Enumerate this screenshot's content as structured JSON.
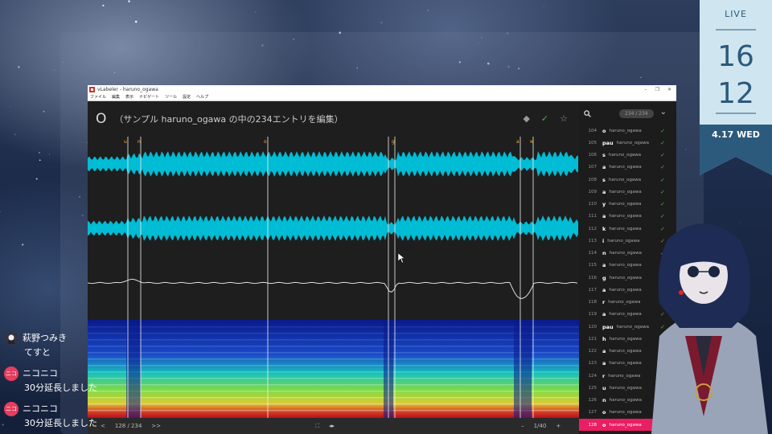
{
  "window": {
    "title": "vLabeler - haruno_ogawa",
    "menu": [
      "ファイル",
      "編集",
      "表示",
      "ナビゲート",
      "ツール",
      "設定",
      "ヘルプ"
    ],
    "controls": [
      "–",
      "❐",
      "✕"
    ]
  },
  "editor": {
    "entry_name": "O",
    "description": "（サンプル haruno_ogawa の中の234エントリを編集）",
    "markers": [
      "u",
      "n",
      "o",
      "g",
      "a",
      "w"
    ],
    "position": "128 / 234",
    "prev_buttons": "<",
    "next_buttons": ">>",
    "zoom": "1/40",
    "minus": "–",
    "plus": "+",
    "accent": "#00bcd4"
  },
  "sidebar": {
    "count": "234 / 234",
    "rows": [
      {
        "index": "104",
        "text": "o",
        "singer": "haruno_ogawa"
      },
      {
        "index": "105",
        "text": "pau",
        "singer": "haruno_ogawa"
      },
      {
        "index": "106",
        "text": "s",
        "singer": "haruno_ogawa"
      },
      {
        "index": "107",
        "text": "a",
        "singer": "haruno_ogawa"
      },
      {
        "index": "108",
        "text": "s",
        "singer": "haruno_ogawa"
      },
      {
        "index": "109",
        "text": "a",
        "singer": "haruno_ogawa"
      },
      {
        "index": "110",
        "text": "y",
        "singer": "haruno_ogawa"
      },
      {
        "index": "111",
        "text": "a",
        "singer": "haruno_ogawa"
      },
      {
        "index": "112",
        "text": "k",
        "singer": "haruno_ogawa"
      },
      {
        "index": "113",
        "text": "i",
        "singer": "haruno_ogawa"
      },
      {
        "index": "114",
        "text": "n",
        "singer": "haruno_ogawa"
      },
      {
        "index": "115",
        "text": "a",
        "singer": "haruno_ogawa"
      },
      {
        "index": "116",
        "text": "g",
        "singer": "haruno_ogawa"
      },
      {
        "index": "117",
        "text": "a",
        "singer": "haruno_ogawa"
      },
      {
        "index": "118",
        "text": "r",
        "singer": "haruno_ogawa"
      },
      {
        "index": "119",
        "text": "a",
        "singer": "haruno_ogawa"
      },
      {
        "index": "120",
        "text": "pau",
        "singer": "haruno_ogawa"
      },
      {
        "index": "121",
        "text": "h",
        "singer": "haruno_ogawa"
      },
      {
        "index": "122",
        "text": "a",
        "singer": "haruno_ogawa"
      },
      {
        "index": "123",
        "text": "a",
        "singer": "haruno_ogawa"
      },
      {
        "index": "124",
        "text": "r",
        "singer": "haruno_ogawa"
      },
      {
        "index": "125",
        "text": "u",
        "singer": "haruno_ogawa"
      },
      {
        "index": "126",
        "text": "n",
        "singer": "haruno_ogawa"
      },
      {
        "index": "127",
        "text": "o",
        "singer": "haruno_ogawa"
      },
      {
        "index": "128",
        "text": "o",
        "singer": "haruno_ogawa"
      }
    ],
    "selected_index": "128",
    "check_color": "#4caf50",
    "selected_color": "#e91e63"
  },
  "chat": [
    {
      "name": "萩野つみき",
      "text": "てすと",
      "avatar": "user-avatar"
    },
    {
      "name": "ニコニコ",
      "text": "30分延長しました",
      "avatar": "nico-badge",
      "badge": "ニコ"
    },
    {
      "name": "ニコニコ",
      "text": "30分延長しました",
      "avatar": "nico-badge",
      "badge": "ニコ"
    }
  ],
  "clock": {
    "label": "LIVE",
    "hour": "16",
    "minute": "12",
    "date": "4.17 WED",
    "color": "#2c5a7c"
  }
}
